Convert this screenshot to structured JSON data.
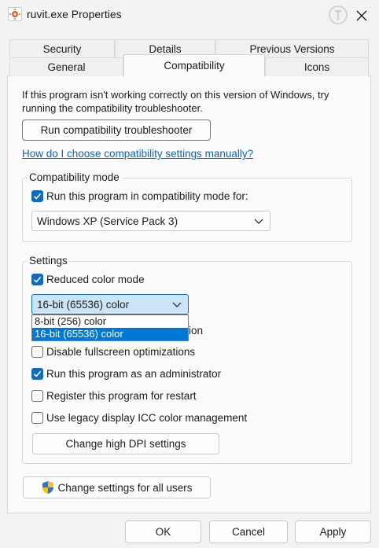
{
  "window": {
    "title": "ruvit.exe Properties",
    "close_icon": "close-icon",
    "app_icon": "application-icon"
  },
  "tabs": {
    "row1": [
      {
        "label": "Security"
      },
      {
        "label": "Details"
      },
      {
        "label": "Previous Versions"
      }
    ],
    "row2": [
      {
        "label": "General"
      },
      {
        "label": "Compatibility",
        "active": true
      },
      {
        "label": "Icons"
      }
    ]
  },
  "compat": {
    "description": "If this program isn't working correctly on this version of Windows, try running the compatibility troubleshooter.",
    "troubleshooter_button": "Run compatibility troubleshooter",
    "help_link": "How do I choose compatibility settings manually?"
  },
  "compat_mode": {
    "group_label": "Compatibility mode",
    "checkbox_label": "Run this program in compatibility mode for:",
    "checked": true,
    "selected_os": "Windows XP (Service Pack 3)"
  },
  "settings": {
    "group_label": "Settings",
    "reduced_color": {
      "label": "Reduced color mode",
      "checked": true
    },
    "color_select": {
      "value": "16-bit (65536) color",
      "options": [
        "8-bit (256) color",
        "16-bit (65536) color"
      ]
    },
    "partial_hidden_text": "ion",
    "disable_fullscreen": {
      "label": "Disable fullscreen optimizations",
      "checked": false
    },
    "run_as_admin": {
      "label": "Run this program as an administrator",
      "checked": true
    },
    "register_restart": {
      "label": "Register this program for restart",
      "checked": false
    },
    "legacy_icc": {
      "label": "Use legacy display ICC color management",
      "checked": false
    },
    "dpi_button": "Change high DPI settings"
  },
  "all_users_button": "Change settings for all users",
  "footer": {
    "ok": "OK",
    "cancel": "Cancel",
    "apply": "Apply"
  },
  "colors": {
    "accent": "#0f6cbd",
    "link": "#0c63c6",
    "dropdown_selected": "#0078d7"
  }
}
